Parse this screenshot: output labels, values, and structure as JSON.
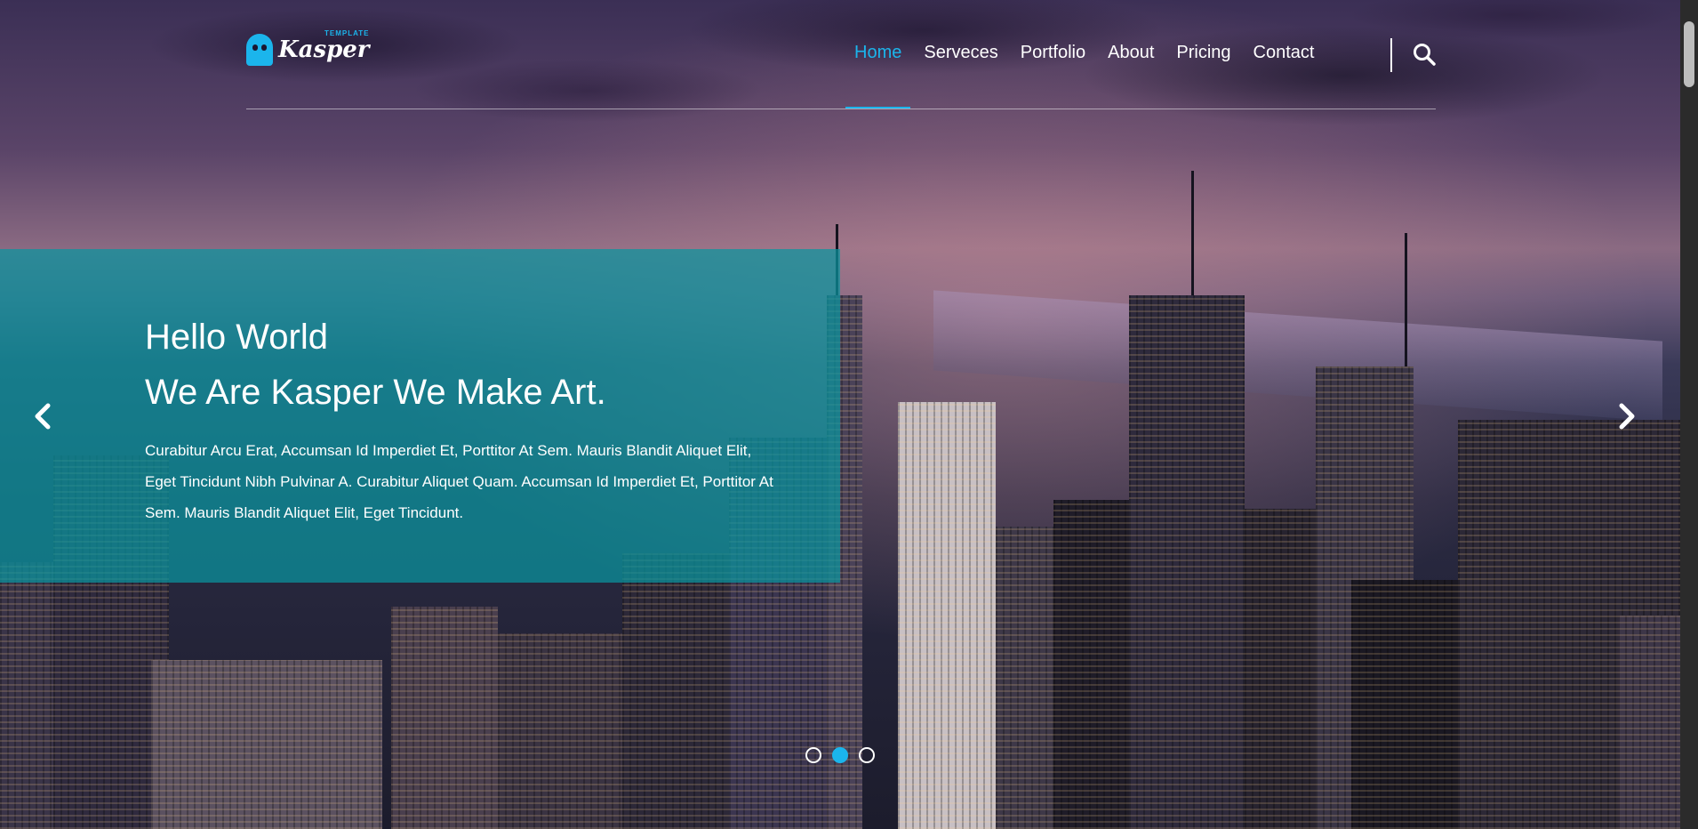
{
  "logo": {
    "name": "Kasper",
    "tag": "TEMPLATE"
  },
  "nav": {
    "items": [
      {
        "label": "Home",
        "active": true
      },
      {
        "label": "Serveces",
        "active": false
      },
      {
        "label": "Portfolio",
        "active": false
      },
      {
        "label": "About",
        "active": false
      },
      {
        "label": "Pricing",
        "active": false
      },
      {
        "label": "Contact",
        "active": false
      }
    ],
    "search_icon": "search-icon"
  },
  "slide": {
    "title_line1": "Hello World",
    "title_line2": "We Are Kasper We Make Art.",
    "text": "Curabitur Arcu Erat, Accumsan Id Imperdiet Et, Porttitor At Sem. Mauris Blandit Aliquet Elit, Eget Tincidunt Nibh Pulvinar A. Curabitur Aliquet Quam. Accumsan Id Imperdiet Et, Porttitor At Sem. Mauris Blandit Aliquet Elit, Eget Tincidunt."
  },
  "carousel": {
    "prev_icon": "chevron-left-icon",
    "next_icon": "chevron-right-icon",
    "slides_count": 3,
    "active_index": 1
  },
  "colors": {
    "accent": "#1bb5ec",
    "overlay": "#0a96a0"
  }
}
